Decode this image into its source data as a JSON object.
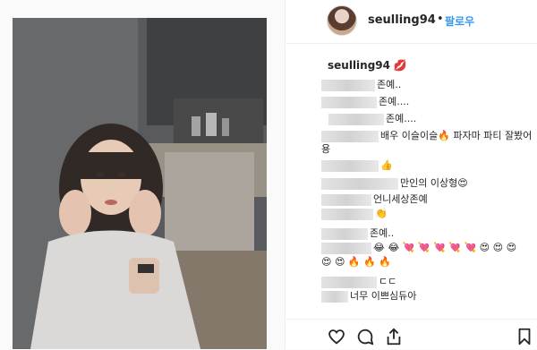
{
  "header": {
    "username": "seulling94",
    "separator": "•",
    "follow_label": "팔로우"
  },
  "caption": {
    "username": "seulling94",
    "emoji": "💋"
  },
  "comments": [
    {
      "text": "존예.."
    },
    {
      "text": "존예...."
    },
    {
      "text": "존예...."
    },
    {
      "text": "배우 이슬이슬🔥  파자마 파티 잘봤어"
    },
    {
      "text": "용"
    },
    {
      "text": "👍"
    },
    {
      "text": "만인의 이상형😍"
    },
    {
      "text": "언니세상존예"
    },
    {
      "text": "👏"
    },
    {
      "text": "존예.."
    },
    {
      "text": "😂 😂 💘 💘 💘 💘 💘 😍 😍 😍"
    },
    {
      "text": "😍 😍 🔥 🔥 🔥"
    },
    {
      "text": "ㄷㄷ"
    },
    {
      "text": "너무 이쁘심듀아"
    }
  ],
  "icons": [
    "heart-icon",
    "comment-icon",
    "share-icon",
    "bookmark-icon"
  ]
}
